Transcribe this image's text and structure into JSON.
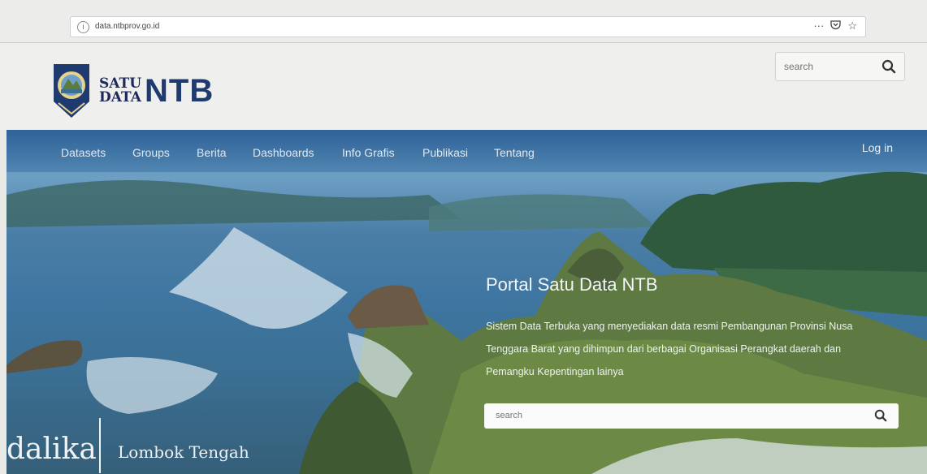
{
  "browser": {
    "url": "data.ntbprov.go.id",
    "info_icon": "info-icon",
    "actions": [
      "···",
      "pocket-icon",
      "star-icon"
    ]
  },
  "header": {
    "logo_line1": "SATU",
    "logo_line2": "DATA",
    "logo_big": "NTB",
    "search_placeholder": "search"
  },
  "nav": {
    "items": [
      "Datasets",
      "Groups",
      "Berita",
      "Dashboards",
      "Info Grafis",
      "Publikasi",
      "Tentang"
    ],
    "login": "Log in"
  },
  "hero": {
    "title": "Portal Satu Data NTB",
    "description": "Sistem Data Terbuka yang menyediakan data resmi Pembangunan Provinsi Nusa Tenggara Barat yang dihimpun dari berbagai Organisasi Perangkat daerah dan Pemangku Kepentingan lainya",
    "search_placeholder": "search",
    "brand_left": "dalika",
    "brand_right": "Lombok Tengah"
  },
  "colors": {
    "brand_navy": "#1f3a6e",
    "nav_blue": "#2c6096"
  }
}
